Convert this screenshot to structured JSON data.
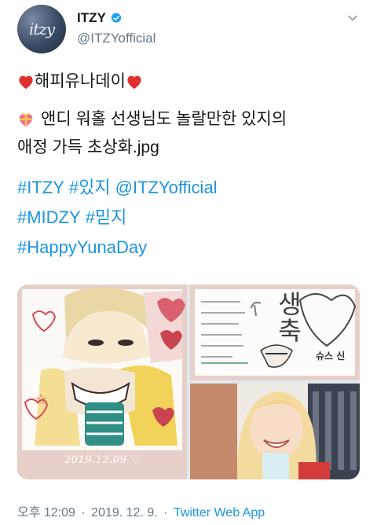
{
  "account": {
    "display_name": "ITZY",
    "handle": "@ITZYofficial",
    "avatar_text": "itzy"
  },
  "tweet": {
    "line1": "해피유나데이",
    "line2": "앤디 워홀 선생님도 놀랄만한 있지의",
    "line3": "애정 가득 초상화.jpg",
    "hashtags": [
      [
        "#ITZY",
        "#있지",
        "@ITZYofficial"
      ],
      [
        "#MIDZY",
        "#믿지"
      ],
      [
        "#HappyYunaDay"
      ]
    ]
  },
  "media": {
    "image1_caption": "2019.12.09 ♡",
    "image2_text": "생축",
    "image2_signature": "슈스 신"
  },
  "meta": {
    "time": "오후 12:09",
    "date": "2019. 12. 9.",
    "separator": "·",
    "source": "Twitter Web App"
  },
  "colors": {
    "link": "#1b95e0",
    "secondary_text": "#657786",
    "verified": "#1da1f2"
  },
  "icons": [
    "verified-badge-icon",
    "chevron-down-icon",
    "red-heart-icon",
    "sparkling-heart-gift-icon"
  ]
}
